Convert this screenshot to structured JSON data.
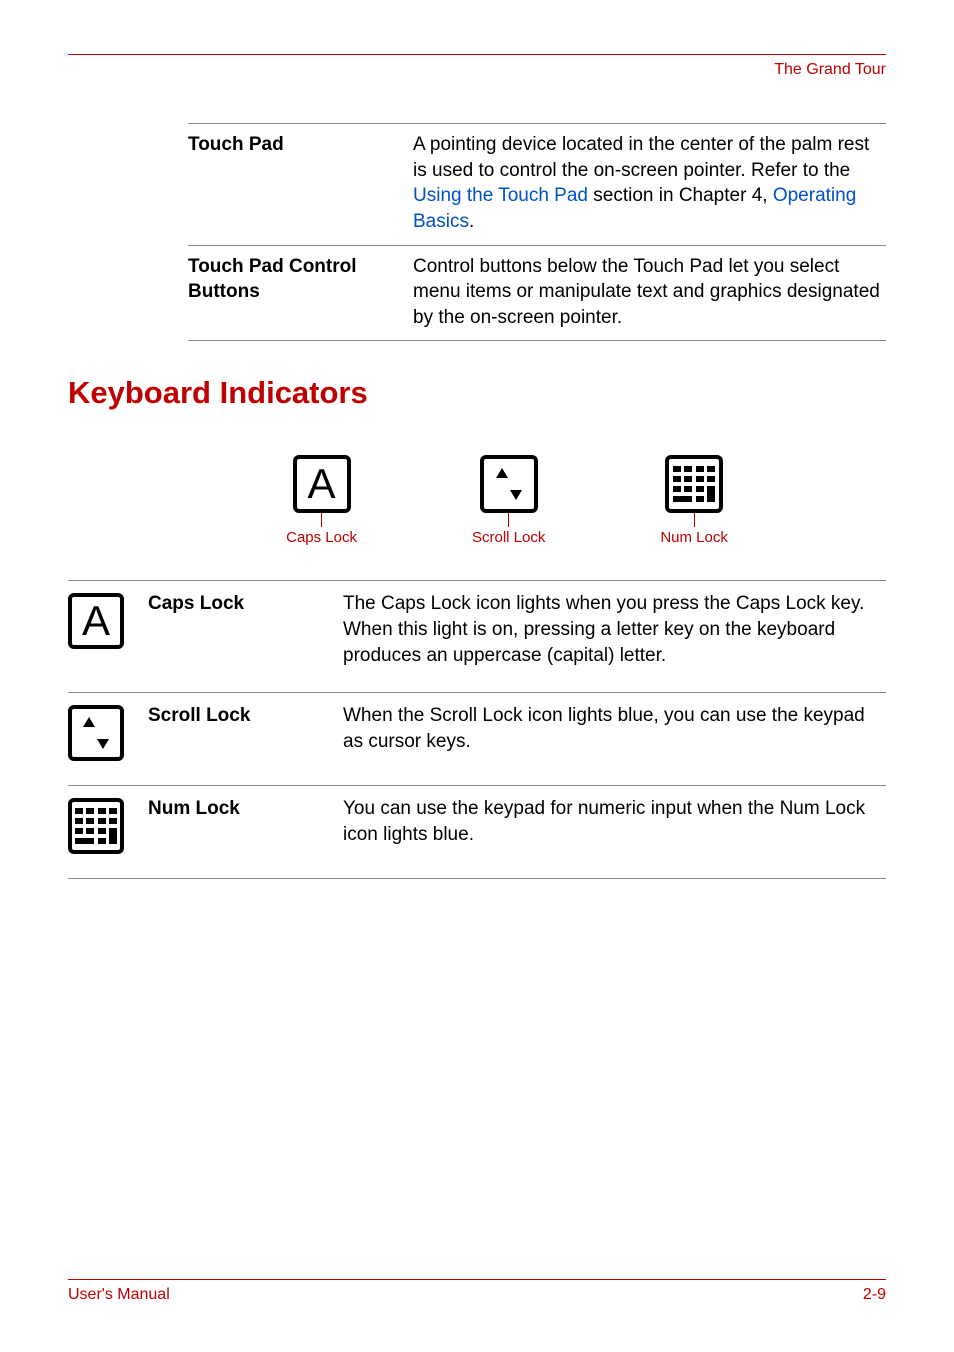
{
  "header": {
    "title": "The Grand Tour"
  },
  "table1": {
    "rows": [
      {
        "term": "Touch Pad",
        "desc_pre": "A pointing device located in the center of the palm rest is used to control the on-screen pointer. Refer to the ",
        "desc_link1": "Using the Touch Pad",
        "desc_mid": " section in Chapter 4, ",
        "desc_link2": "Operating Basics",
        "desc_post": "."
      },
      {
        "term": "Touch Pad Control Buttons",
        "desc": "Control buttons below the Touch Pad let you select menu items or manipulate text and graphics designated by the on-screen pointer."
      }
    ]
  },
  "section_title": "Keyboard Indicators",
  "icons": {
    "caps": "Caps Lock",
    "scroll": "Scroll Lock",
    "num": "Num Lock"
  },
  "indicators": [
    {
      "name": "caps-lock",
      "term": "Caps Lock",
      "desc": "The Caps Lock icon lights when you press the Caps Lock key. When this light is on, pressing a letter key on the keyboard produces an uppercase (capital) letter."
    },
    {
      "name": "scroll-lock",
      "term": "Scroll Lock",
      "desc": "When the Scroll Lock icon lights blue, you can use the keypad as cursor keys."
    },
    {
      "name": "num-lock",
      "term": "Num Lock",
      "desc": "You can use the keypad for numeric input when the Num Lock icon lights blue."
    }
  ],
  "footer": {
    "left": "User's Manual",
    "right": "2-9"
  }
}
